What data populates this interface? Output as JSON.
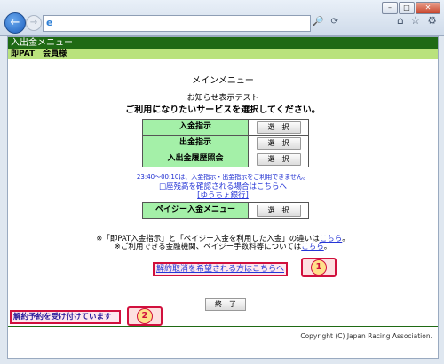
{
  "browser": {
    "back_label": "←",
    "forward_label": "→",
    "ie_icon": "e",
    "search_icon": "🔎",
    "refresh_label": "⟳",
    "window_buttons": [
      "–",
      "□",
      "✕"
    ],
    "home_label": "⌂",
    "star_label": "☆",
    "gear_label": "⚙"
  },
  "header": {
    "title": "入出金メニュー",
    "user": "即PAT　会員様"
  },
  "main": {
    "title": "メインメニュー",
    "notice": "お知らせ表示テスト",
    "prompt": "ご利用になりたいサービスを選択してください。",
    "menu_items": [
      {
        "label": "入金指示",
        "button": "選　択"
      },
      {
        "label": "出金指示",
        "button": "選　択"
      },
      {
        "label": "入出金履歴照会",
        "button": "選　択"
      }
    ],
    "hours_note": "23:40～00:10は、入金指示・出金指示をご利用できません。",
    "balance_link": "□座残高を確認される場合はこちらへ",
    "yucho_link": "[ゆうちょ銀行]",
    "payeasy_menu": {
      "label": "ペイジー入金メニュー",
      "button": "選　択"
    },
    "note1_prefix": "※「即PAT入金指示」と「ペイジー入金を利用した入金」の違いは",
    "note1_link": "こちら",
    "note1_suffix": "。",
    "note2_prefix": "※ご利用できる金融機関、ペイジー手数料等については",
    "note2_link": "こちら",
    "note2_suffix": "。",
    "cancel_link": "解約取消を希望される方はこちらへ",
    "finish_button": "終　了",
    "status_text": "解約予約を受け付けています",
    "badge1": "1",
    "badge2": "2"
  },
  "footer": {
    "copyright": "Copyright (C) Japan Racing Association."
  },
  "colors": {
    "header_dark": "#1f6a14",
    "header_light": "#b9e27c",
    "menu_green": "#a4f0a8",
    "annotation_red": "#d1103d",
    "link_blue": "#2636d6"
  }
}
